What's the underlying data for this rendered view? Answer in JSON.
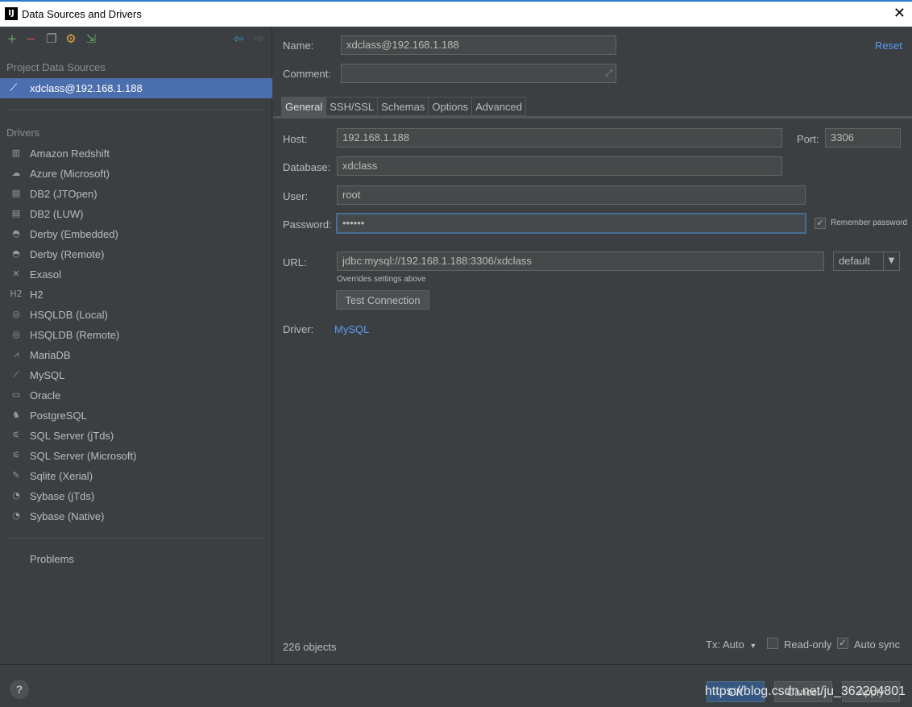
{
  "window": {
    "title": "Data Sources and Drivers",
    "app_icon": "IJ",
    "close_glyph": "✕"
  },
  "left": {
    "toolbar": [
      {
        "icon": "add-icon",
        "glyph": "+",
        "color": "#59a869"
      },
      {
        "icon": "remove-icon",
        "glyph": "−",
        "color": "#c75450"
      },
      {
        "icon": "copy-icon",
        "glyph": "❐",
        "color": "#9a9a9a"
      },
      {
        "icon": "driver-settings-icon",
        "glyph": "⚙",
        "color": "#d9a343"
      },
      {
        "icon": "import-icon",
        "glyph": "⇲",
        "color": "#59a869"
      },
      {
        "icon": "back-icon",
        "glyph": "⇦",
        "color": "#3592c4"
      },
      {
        "icon": "forward-icon",
        "glyph": "⇨",
        "color": "#5a5d5f"
      }
    ],
    "project_section": "Project Data Sources",
    "selected_source": "xdclass@192.168.1.188",
    "drivers_section": "Drivers",
    "drivers": [
      {
        "icon": "redshift-icon",
        "glyph": "▥",
        "label": "Amazon Redshift"
      },
      {
        "icon": "azure-icon",
        "glyph": "☁",
        "label": "Azure (Microsoft)"
      },
      {
        "icon": "ibm-db2-icon",
        "glyph": "▤",
        "label": "DB2 (JTOpen)"
      },
      {
        "icon": "ibm-db2-icon",
        "glyph": "▤",
        "label": "DB2 (LUW)"
      },
      {
        "icon": "derby-icon",
        "glyph": "◓",
        "label": "Derby (Embedded)"
      },
      {
        "icon": "derby-icon",
        "glyph": "◓",
        "label": "Derby (Remote)"
      },
      {
        "icon": "exasol-icon",
        "glyph": "✕",
        "label": "Exasol"
      },
      {
        "icon": "h2-icon",
        "glyph": "H2",
        "label": "H2"
      },
      {
        "icon": "hsqldb-icon",
        "glyph": "◎",
        "label": "HSQLDB (Local)"
      },
      {
        "icon": "hsqldb-icon",
        "glyph": "◎",
        "label": "HSQLDB (Remote)"
      },
      {
        "icon": "mariadb-icon",
        "glyph": "⩘",
        "label": "MariaDB"
      },
      {
        "icon": "mysql-icon",
        "glyph": "⟋",
        "label": "MySQL"
      },
      {
        "icon": "oracle-icon",
        "glyph": "▭",
        "label": "Oracle"
      },
      {
        "icon": "postgresql-icon",
        "glyph": "♞",
        "label": "PostgreSQL"
      },
      {
        "icon": "sqlserver-icon",
        "glyph": "⚟",
        "label": "SQL Server (jTds)"
      },
      {
        "icon": "sqlserver-icon",
        "glyph": "⚟",
        "label": "SQL Server (Microsoft)"
      },
      {
        "icon": "sqlite-icon",
        "glyph": "✎",
        "label": "Sqlite (Xerial)"
      },
      {
        "icon": "sybase-icon",
        "glyph": "◔",
        "label": "Sybase (jTds)"
      },
      {
        "icon": "sybase-icon",
        "glyph": "◔",
        "label": "Sybase (Native)"
      }
    ],
    "problems": "Problems"
  },
  "right": {
    "name_label": "Name:",
    "name_value": "xdclass@192.168.1.188",
    "reset": "Reset",
    "comment_label": "Comment:",
    "comment_value": "",
    "tabs": [
      "General",
      "SSH/SSL",
      "Schemas",
      "Options",
      "Advanced"
    ],
    "active_tab": "General",
    "host_label": "Host:",
    "host_value": "192.168.1.188",
    "port_label": "Port:",
    "port_value": "3306",
    "database_label": "Database:",
    "database_value": "xdclass",
    "user_label": "User:",
    "user_value": "root",
    "password_label": "Password:",
    "password_value": "••••••",
    "remember_password": "Remember password",
    "remember_checked": true,
    "url_label": "URL:",
    "url_value": "jdbc:mysql://192.168.1.188:3306/xdclass",
    "url_mode": "default",
    "overrides_note": "Overrides settings above",
    "test_connection": "Test Connection",
    "driver_label": "Driver:",
    "driver_value": "MySQL",
    "objects": "226 objects",
    "tx": "Tx: Auto",
    "read_only": "Read-only",
    "read_only_checked": false,
    "auto_sync": "Auto sync",
    "auto_sync_checked": true
  },
  "bottom": {
    "help": "?",
    "ok": "OK",
    "cancel": "Cancel",
    "apply": "Apply",
    "watermark": "https://blog.csdn.net/ju_362204801"
  }
}
